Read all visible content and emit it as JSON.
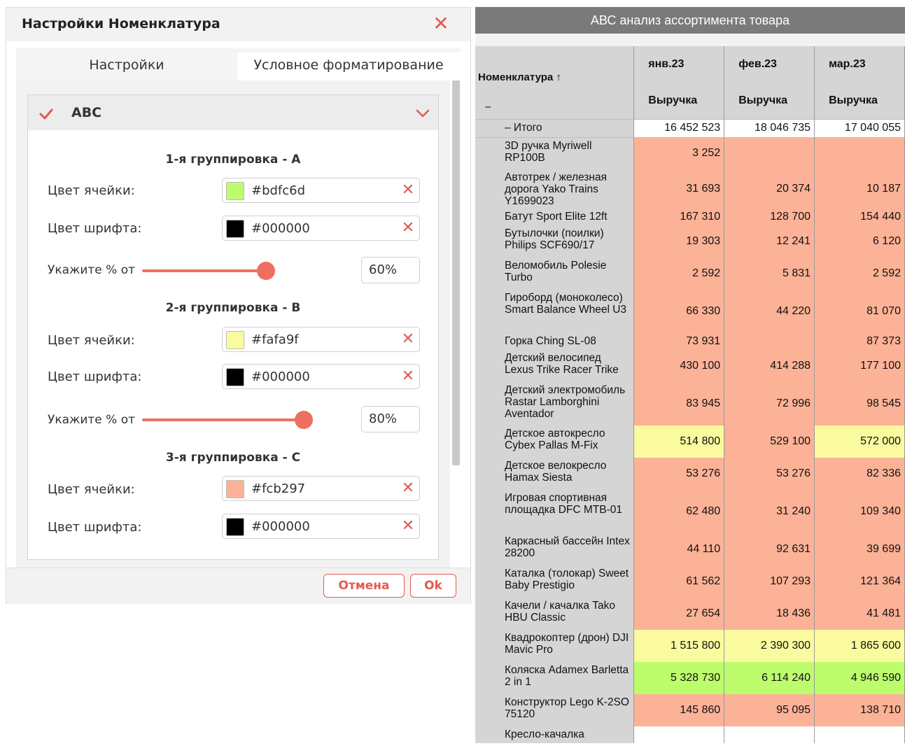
{
  "dialog": {
    "title": "Настройки Номенклатура",
    "tabs": [
      "Настройки",
      "Условное форматирование"
    ],
    "section_title": "ABC",
    "groups": [
      {
        "title": "1-я группировка - А",
        "cell_label": "Цвет ячейки:",
        "cell_color": "#bdfc6d",
        "font_label": "Цвет шрифта:",
        "font_color": "#000000",
        "percent_label": "Укажите % от",
        "percent": "60%"
      },
      {
        "title": "2-я группировка - B",
        "cell_label": "Цвет ячейки:",
        "cell_color": "#fafa9f",
        "font_label": "Цвет шрифта:",
        "font_color": "#000000",
        "percent_label": "Укажите % от",
        "percent": "80%"
      },
      {
        "title": "3-я группировка - С",
        "cell_label": "Цвет ячейки:",
        "cell_color": "#fcb297",
        "font_label": "Цвет шрифта:",
        "font_color": "#000000"
      }
    ],
    "cancel_label": "Отмена",
    "ok_label": "Ok"
  },
  "report": {
    "title": "АВС анализ ассортимента товара",
    "row_header": "Номенклатура ↑",
    "collapse_symbol": "–",
    "months": [
      "янв.23",
      "фев.23",
      "мар.23"
    ],
    "measure": "Выручка",
    "total": {
      "label": "– Итого",
      "values": [
        "16 452 523",
        "18 046 735",
        "17 040 055"
      ]
    },
    "rows": [
      {
        "name": "3D ручка Myriwell RP100B",
        "values": [
          "3 252",
          "",
          ""
        ],
        "classes": [
          "C",
          "C",
          "C"
        ]
      },
      {
        "name": "Автотрек / железная дорога Yako Trains Y1699023",
        "values": [
          "31 693",
          "20 374",
          "10 187"
        ],
        "classes": [
          "C",
          "C",
          "C"
        ]
      },
      {
        "name": "Батут Sport Elite 12ft",
        "values": [
          "167 310",
          "128 700",
          "154 440"
        ],
        "classes": [
          "C",
          "C",
          "C"
        ]
      },
      {
        "name": "Бутылочки (поилки) Philips SCF690/17",
        "values": [
          "19 303",
          "12 241",
          "6 120"
        ],
        "classes": [
          "C",
          "C",
          "C"
        ]
      },
      {
        "name": "Веломобиль Polesie Turbo",
        "values": [
          "2 592",
          "5 831",
          "2 592"
        ],
        "classes": [
          "C",
          "C",
          "C"
        ]
      },
      {
        "name": "Гироборд (моноколесо) Smart Balance Wheel U3",
        "values": [
          "66 330",
          "44 220",
          "81 070"
        ],
        "classes": [
          "C",
          "C",
          "C"
        ]
      },
      {
        "name": "Горка Ching SL-08",
        "values": [
          "73 931",
          "",
          "87 373"
        ],
        "classes": [
          "C",
          "C",
          "C"
        ]
      },
      {
        "name": "Детский велосипед Lexus Trike Racer Trike",
        "values": [
          "430 100",
          "414 288",
          "177 100"
        ],
        "classes": [
          "C",
          "C",
          "C"
        ]
      },
      {
        "name": "Детский электромобиль Rastar Lamborghini Aventador",
        "values": [
          "83 945",
          "72 996",
          "98 545"
        ],
        "classes": [
          "C",
          "C",
          "C"
        ]
      },
      {
        "name": "Детское автокресло Cybex Pallas M-Fix",
        "values": [
          "514 800",
          "529 100",
          "572 000"
        ],
        "classes": [
          "B",
          "C",
          "B"
        ]
      },
      {
        "name": "Детское велокресло Hamax Siesta",
        "values": [
          "53 276",
          "53 276",
          "82 336"
        ],
        "classes": [
          "C",
          "C",
          "C"
        ]
      },
      {
        "name": "Игровая спортивная площадка DFC MTB-01",
        "values": [
          "62 480",
          "31 240",
          "109 340"
        ],
        "classes": [
          "C",
          "C",
          "C"
        ]
      },
      {
        "name": "Каркасный бассейн Intex 28200",
        "values": [
          "44 110",
          "92 631",
          "39 699"
        ],
        "classes": [
          "C",
          "C",
          "C"
        ]
      },
      {
        "name": "Каталка (толокар) Sweet Baby Prestigio",
        "values": [
          "61 562",
          "107 293",
          "121 364"
        ],
        "classes": [
          "C",
          "C",
          "C"
        ]
      },
      {
        "name": "Качели / качалка Tako HBU Classic",
        "values": [
          "27 654",
          "18 436",
          "41 481"
        ],
        "classes": [
          "C",
          "C",
          "C"
        ]
      },
      {
        "name": "Квадрокоптер (дрон) DJI Mavic Pro",
        "values": [
          "1 515 800",
          "2 390 300",
          "1 865 600"
        ],
        "classes": [
          "B",
          "B",
          "B"
        ]
      },
      {
        "name": "Коляска Adamex Barletta 2 in 1",
        "values": [
          "5 328 730",
          "6 114 240",
          "4 946 590"
        ],
        "classes": [
          "A",
          "A",
          "A"
        ]
      },
      {
        "name": "Конструктор Lego K-2SO 75120",
        "values": [
          "145 860",
          "95 095",
          "138 710"
        ],
        "classes": [
          "C",
          "C",
          "C"
        ]
      },
      {
        "name": "Кресло-качалка",
        "values": [
          "",
          "",
          ""
        ],
        "classes": [
          "W",
          "W",
          "W"
        ]
      }
    ]
  }
}
